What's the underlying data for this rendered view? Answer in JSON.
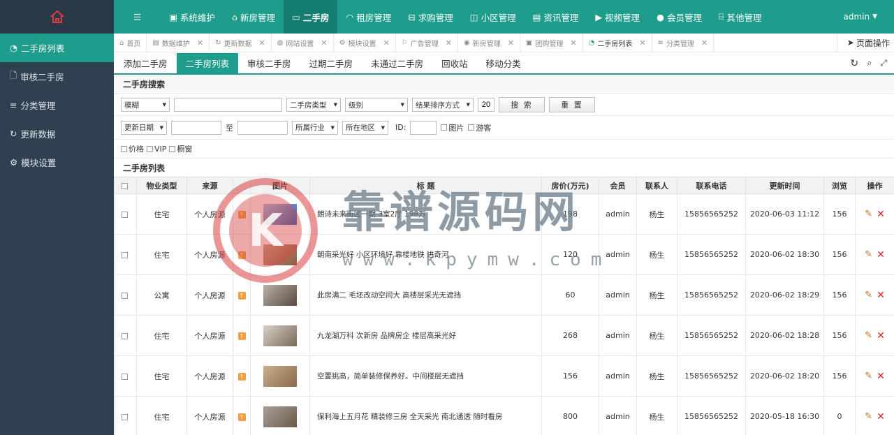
{
  "sidebar": {
    "items": [
      {
        "label": "二手房列表"
      },
      {
        "label": "审核二手房"
      },
      {
        "label": "分类管理"
      },
      {
        "label": "更新数据"
      },
      {
        "label": "模块设置"
      }
    ]
  },
  "topnav": {
    "items": [
      {
        "label": "系统维护"
      },
      {
        "label": "新房管理"
      },
      {
        "label": "二手房"
      },
      {
        "label": "租房管理"
      },
      {
        "label": "求购管理"
      },
      {
        "label": "小区管理"
      },
      {
        "label": "资讯管理"
      },
      {
        "label": "视频管理"
      },
      {
        "label": "会员管理"
      },
      {
        "label": "其他管理"
      }
    ],
    "user": "admin"
  },
  "tabs": {
    "items": [
      {
        "label": "首页"
      },
      {
        "label": "数据维护"
      },
      {
        "label": "更新数据"
      },
      {
        "label": "网站设置"
      },
      {
        "label": "模块设置"
      },
      {
        "label": "广告管理"
      },
      {
        "label": "新房管理"
      },
      {
        "label": "团购管理"
      },
      {
        "label": "二手房列表"
      },
      {
        "label": "分类管理"
      }
    ],
    "page_ops": "页面操作"
  },
  "subnav": {
    "items": [
      {
        "label": "添加二手房"
      },
      {
        "label": "二手房列表"
      },
      {
        "label": "审核二手房"
      },
      {
        "label": "过期二手房"
      },
      {
        "label": "未通过二手房"
      },
      {
        "label": "回收站"
      },
      {
        "label": "移动分类"
      }
    ]
  },
  "search": {
    "title": "二手房搜索",
    "mode": "模糊",
    "keyword": "",
    "type": "二手房类型",
    "level": "级别",
    "sort": "结果排序方式",
    "pagesize": "20",
    "search_btn": "搜 索",
    "reset_btn": "重 置",
    "date_field": "更新日期",
    "date_to": "至",
    "industry": "所属行业",
    "area": "所在地区",
    "id_label": "ID:",
    "opt_pic": "图片",
    "opt_guest": "游客",
    "opt_price": "价格",
    "opt_vip": "VIP",
    "opt_window": "橱窗"
  },
  "list": {
    "title": "二手房列表",
    "columns": [
      "物业类型",
      "来源",
      "图片",
      "标 题",
      "房价(万元)",
      "会员",
      "联系人",
      "联系电话",
      "更新时间",
      "浏览",
      "操作"
    ],
    "rows": [
      {
        "type": "住宅",
        "source": "个人房源",
        "title": "朗诗未来街区一期 3室2厅 198万",
        "price": "198",
        "member": "admin",
        "contact": "杨生",
        "phone": "15856565252",
        "time": "2020-06-03 11:12",
        "views": "156"
      },
      {
        "type": "住宅",
        "source": "个人房源",
        "title": "朝南采光好 小区环境好 靠楼地铁 进奇河",
        "price": "120",
        "member": "admin",
        "contact": "杨生",
        "phone": "15856565252",
        "time": "2020-06-02 18:30",
        "views": "156"
      },
      {
        "type": "公寓",
        "source": "个人房源",
        "title": "此房满二 毛坯改动空间大 高楼层采光无遮挡",
        "price": "60",
        "member": "admin",
        "contact": "杨生",
        "phone": "15856565252",
        "time": "2020-06-02 18:29",
        "views": "156"
      },
      {
        "type": "住宅",
        "source": "个人房源",
        "title": "九龙湖万科 次新房 品牌房企 楼层高采光好",
        "price": "268",
        "member": "admin",
        "contact": "杨生",
        "phone": "15856565252",
        "time": "2020-06-02 18:28",
        "views": "156"
      },
      {
        "type": "住宅",
        "source": "个人房源",
        "title": "空置挑高，简单装修保养好。中间楼层无遮挡",
        "price": "156",
        "member": "admin",
        "contact": "杨生",
        "phone": "15856565252",
        "time": "2020-06-02 18:20",
        "views": "156"
      },
      {
        "type": "住宅",
        "source": "个人房源",
        "title": "保利海上五月花 精装修三房 全天采光 南北通透 随时看房",
        "price": "800",
        "member": "admin",
        "contact": "杨生",
        "phone": "15856565252",
        "time": "2020-05-18 16:30",
        "views": "0"
      }
    ]
  },
  "watermark": {
    "text": "靠谱源码网",
    "url": "www.kpymw.com"
  },
  "colors": {
    "accent": "#1e9c8c",
    "sidebar": "#2f4050",
    "delete": "#e02020"
  }
}
